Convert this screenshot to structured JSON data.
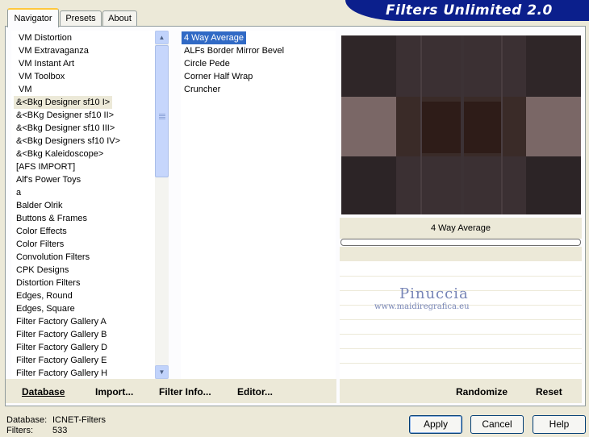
{
  "tabs": [
    {
      "label": "Navigator",
      "active": true
    },
    {
      "label": "Presets",
      "active": false
    },
    {
      "label": "About",
      "active": false
    }
  ],
  "banner": {
    "title": "Filters Unlimited 2.0"
  },
  "categories": [
    "VM Distortion",
    "VM Extravaganza",
    "VM Instant Art",
    "VM Toolbox",
    "VM",
    "&<Bkg Designer sf10 I>",
    "&<BKg Designer sf10 II>",
    "&<Bkg Designer sf10 III>",
    "&<Bkg Designers sf10 IV>",
    "&<Bkg Kaleidoscope>",
    "[AFS IMPORT]",
    "Alf's Power Toys",
    "a",
    "Balder Olrik",
    "Buttons & Frames",
    "Color Effects",
    "Color Filters",
    "Convolution Filters",
    "CPK Designs",
    "Distortion Filters",
    "Edges, Round",
    "Edges, Square",
    "Filter Factory Gallery A",
    "Filter Factory Gallery B",
    "Filter Factory Gallery D",
    "Filter Factory Gallery E",
    "Filter Factory Gallery H"
  ],
  "selected_category_index": 5,
  "filters": [
    "4 Way Average",
    "ALFs Border Mirror Bevel",
    "Circle Pede",
    "Corner Half Wrap",
    "Cruncher"
  ],
  "selected_filter_index": 0,
  "preview": {
    "filter_name": "4 Way Average"
  },
  "bottom_buttons": {
    "database": "Database",
    "import": "Import...",
    "filter_info": "Filter Info...",
    "editor": "Editor...",
    "randomize": "Randomize",
    "reset": "Reset"
  },
  "info": {
    "database_label": "Database:",
    "database_value": "ICNET-Filters",
    "filters_label": "Filters:",
    "filters_value": "533"
  },
  "dialog_buttons": {
    "apply": "Apply",
    "cancel": "Cancel",
    "help": "Help"
  },
  "watermark": {
    "name": "Pinuccia",
    "url": "www.maidiregrafica.eu"
  },
  "colors": {
    "selection": "#316ac5",
    "banner": "#0b1f8c",
    "dialog_bg": "#ece9d8"
  }
}
